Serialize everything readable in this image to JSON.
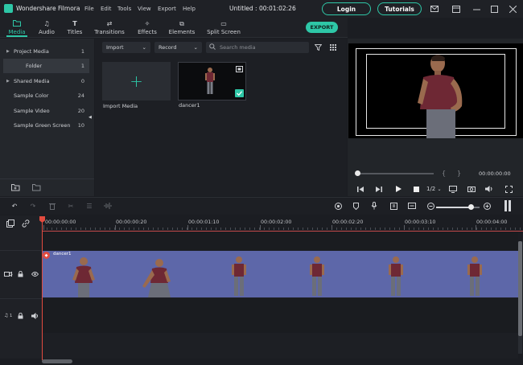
{
  "titlebar": {
    "app_name": "Wondershare Filmora",
    "menus": [
      "File",
      "Edit",
      "Tools",
      "View",
      "Export",
      "Help"
    ],
    "document_title": "Untitled : 00:01:02:26",
    "login_label": "Login",
    "tutorials_label": "Tutorials"
  },
  "toolbar": {
    "tabs": [
      "Media",
      "Audio",
      "Titles",
      "Transitions",
      "Effects",
      "Elements",
      "Split Screen"
    ],
    "active_tab": "Media",
    "export_label": "EXPORT"
  },
  "left_panel": {
    "items": [
      {
        "label": "Project Media",
        "count": "1",
        "expandable": true
      },
      {
        "label": "Folder",
        "count": "1",
        "selected": true
      },
      {
        "label": "Shared Media",
        "count": "0",
        "expandable": true
      },
      {
        "label": "Sample Color",
        "count": "24"
      },
      {
        "label": "Sample Video",
        "count": "20"
      },
      {
        "label": "Sample Green Screen",
        "count": "10"
      }
    ]
  },
  "media": {
    "import_dropdown": "Import",
    "record_dropdown": "Record",
    "search_placeholder": "Search media",
    "import_tile_label": "Import Media",
    "clip_name": "dancer1"
  },
  "preview": {
    "timecode": "00:00:00:00",
    "quality": "1/2"
  },
  "timeline": {
    "ruler_labels": [
      "00:00:00:00",
      "00:00:00:20",
      "00:00:01:10",
      "00:00:02:00",
      "00:00:02:20",
      "00:00:03:10",
      "00:00:04:00"
    ],
    "clip_label": "dancer1",
    "video_track_number": "1",
    "audio_track_number": "1"
  },
  "colors": {
    "accent": "#2ec7a7",
    "playhead": "#e24b3f",
    "video_track": "#5d67a9",
    "shirt": "#6e2834"
  }
}
